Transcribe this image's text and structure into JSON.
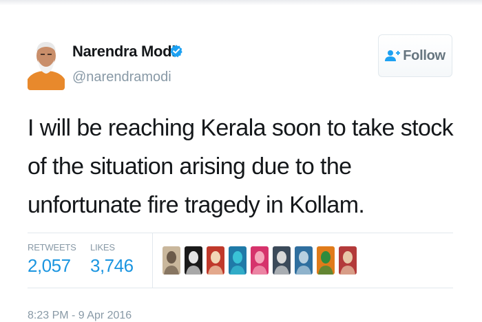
{
  "user": {
    "name": "Narendra Modi",
    "handle": "@narendramodi",
    "verified": true,
    "verified_color": "#1da1f2"
  },
  "follow_button": {
    "label": "Follow",
    "icon": "add-user-icon"
  },
  "tweet": {
    "text": "I will be reaching Kerala soon to take stock of the situation arising due to the unfortunate fire tragedy in Kollam."
  },
  "stats": {
    "retweets_label": "RETWEETS",
    "retweets_value": "2,057",
    "likes_label": "LIKES",
    "likes_value": "3,746"
  },
  "likers": [
    {
      "colors": [
        "#c9b79c",
        "#6b5a4a"
      ]
    },
    {
      "colors": [
        "#1a1a1a",
        "#e6e6e6"
      ]
    },
    {
      "colors": [
        "#c0392b",
        "#f2d7b6"
      ]
    },
    {
      "colors": [
        "#1f7aa8",
        "#39c2d6"
      ]
    },
    {
      "colors": [
        "#d6336c",
        "#f4a7bb"
      ]
    },
    {
      "colors": [
        "#3b4a5a",
        "#d9d9d9"
      ]
    },
    {
      "colors": [
        "#2f6f9f",
        "#b8d0e0"
      ]
    },
    {
      "colors": [
        "#e07b1a",
        "#2e8b3d"
      ]
    },
    {
      "colors": [
        "#b33a3a",
        "#e8c8a8"
      ]
    }
  ],
  "timestamp": "8:23 PM - 9 Apr 2016",
  "accent_color": "#1b95e0"
}
